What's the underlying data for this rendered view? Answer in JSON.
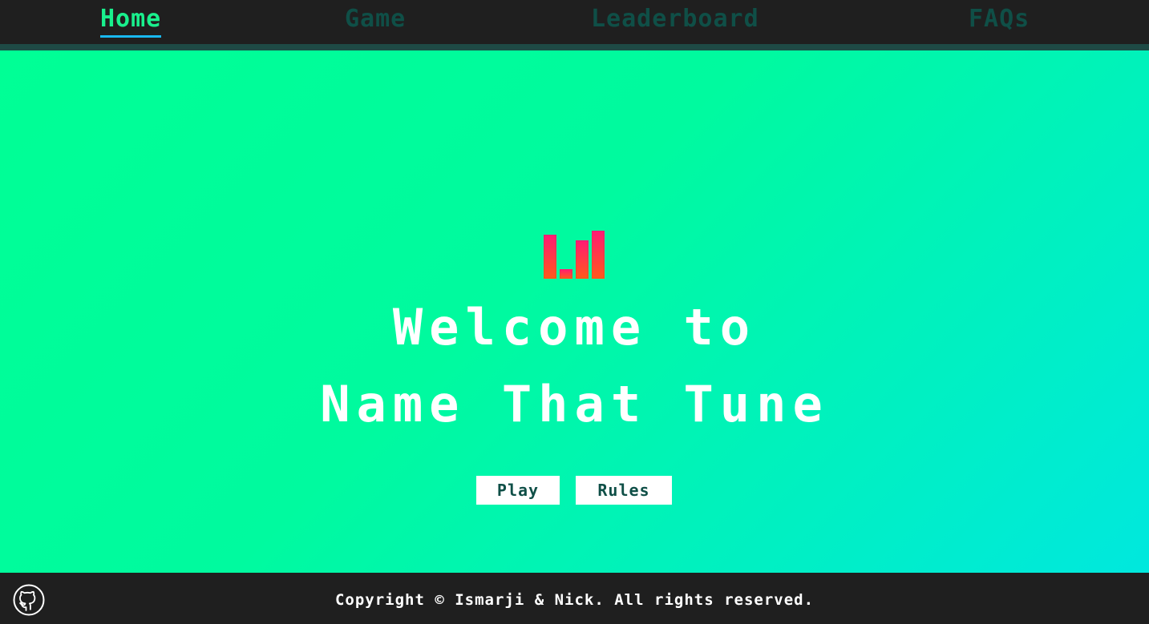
{
  "nav": {
    "items": [
      {
        "label": "Home",
        "active": true
      },
      {
        "label": "Game",
        "active": false
      },
      {
        "label": "Leaderboard",
        "active": false
      },
      {
        "label": "FAQs",
        "active": false
      }
    ]
  },
  "hero": {
    "logo_icon": "equalizer-bars-icon",
    "title_line1": "Welcome to",
    "title_line2": "Name That Tune",
    "play_label": "Play",
    "rules_label": "Rules"
  },
  "footer": {
    "github_icon": "github-icon",
    "copyright": "Copyright © Ismarji & Nick. All rights reserved."
  },
  "colors": {
    "nav_bg": "#1f1f1f",
    "nav_active": "#19f08d",
    "nav_inactive": "#0f4f47",
    "active_underline": "#19b8f0",
    "hero_gradient_start": "#00ff95",
    "hero_gradient_end": "#00e8de",
    "logo_top": "#ff1a75",
    "logo_bottom": "#ff5a1a"
  }
}
